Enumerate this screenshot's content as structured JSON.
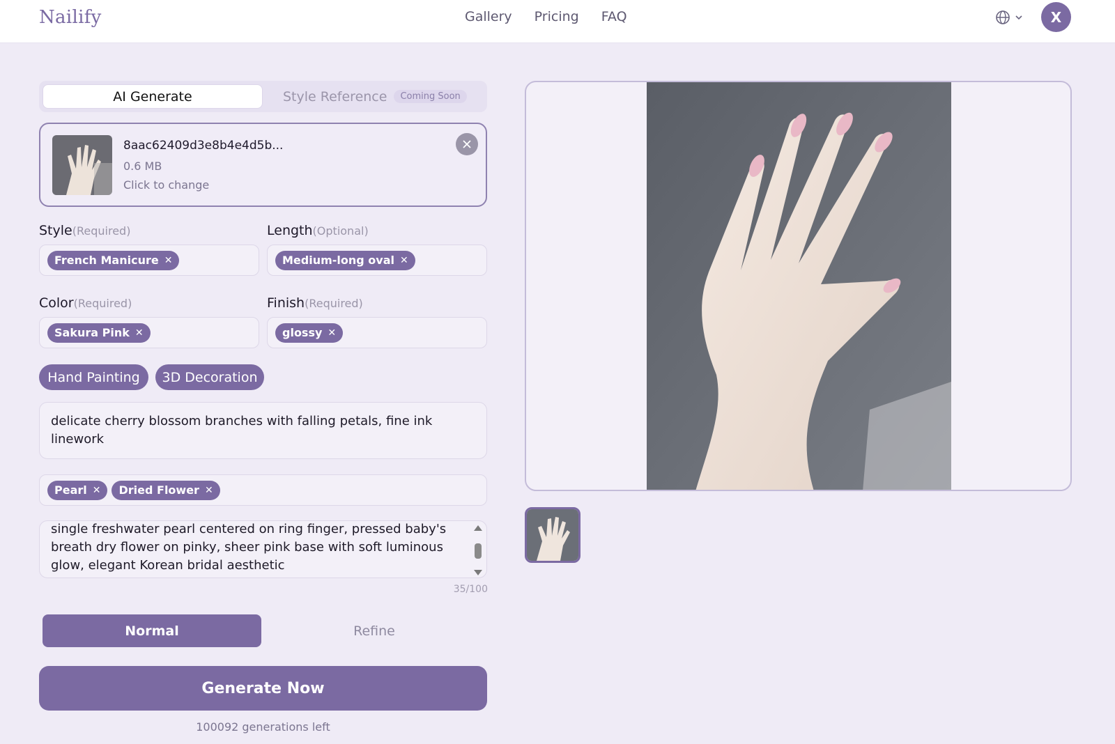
{
  "header": {
    "logo": "Nailify",
    "nav": [
      "Gallery",
      "Pricing",
      "FAQ"
    ],
    "avatar_initial": "X",
    "language_icon": "globe-icon"
  },
  "tabs": {
    "active": "AI Generate",
    "inactive": "Style Reference",
    "badge": "Coming Soon"
  },
  "upload": {
    "file_name": "8aac62409d3e8b4e4d5b...",
    "file_size": "0.6 MB",
    "hint": "Click to change"
  },
  "fields": {
    "style": {
      "label": "Style",
      "hint": "(Required)",
      "chips": [
        "French Manicure"
      ]
    },
    "length": {
      "label": "Length",
      "hint": "(Optional)",
      "chips": [
        "Medium-long oval"
      ]
    },
    "color": {
      "label": "Color",
      "hint": "(Required)",
      "chips": [
        "Sakura Pink"
      ]
    },
    "finish": {
      "label": "Finish",
      "hint": "(Required)",
      "chips": [
        "glossy"
      ]
    }
  },
  "extras": [
    "Hand Painting",
    "3D Decoration"
  ],
  "painting_prompt": "delicate cherry blossom branches with falling petals, fine ink linework",
  "decorations": [
    "Pearl",
    "Dried Flower"
  ],
  "description": "single freshwater pearl centered on ring finger, pressed baby's breath dry flower on pinky, sheer pink base with soft luminous glow, elegant Korean bridal aesthetic",
  "counter": "35/100",
  "modes": {
    "normal": "Normal",
    "refine": "Refine"
  },
  "generate_label": "Generate Now",
  "generations_left": "100092 generations left",
  "colors": {
    "accent": "#7b6aa2",
    "background": "#efebf6"
  }
}
